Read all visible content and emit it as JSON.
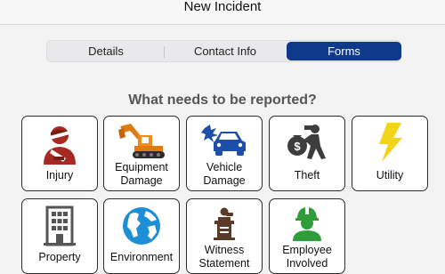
{
  "header": {
    "title": "New Incident"
  },
  "tabs": [
    {
      "label": "Details",
      "active": false
    },
    {
      "label": "Contact Info",
      "active": false
    },
    {
      "label": "Forms",
      "active": true
    }
  ],
  "accent_color": "#0f3a8c",
  "question": "What needs to be reported?",
  "tiles": [
    {
      "icon": "injury-icon",
      "label_line1": "Injury",
      "label_line2": ""
    },
    {
      "icon": "equipment-damage-icon",
      "label_line1": "Equipment",
      "label_line2": "Damage"
    },
    {
      "icon": "vehicle-damage-icon",
      "label_line1": "Vehicle",
      "label_line2": "Damage"
    },
    {
      "icon": "theft-icon",
      "label_line1": "Theft",
      "label_line2": ""
    },
    {
      "icon": "utility-icon",
      "label_line1": "Utility",
      "label_line2": ""
    },
    {
      "icon": "property-icon",
      "label_line1": "Property",
      "label_line2": ""
    },
    {
      "icon": "environment-icon",
      "label_line1": "Environment",
      "label_line2": ""
    },
    {
      "icon": "witness-statement-icon",
      "label_line1": "Witness",
      "label_line2": "Statement"
    },
    {
      "icon": "employee-involved-icon",
      "label_line1": "Employee",
      "label_line2": "Involved"
    }
  ]
}
